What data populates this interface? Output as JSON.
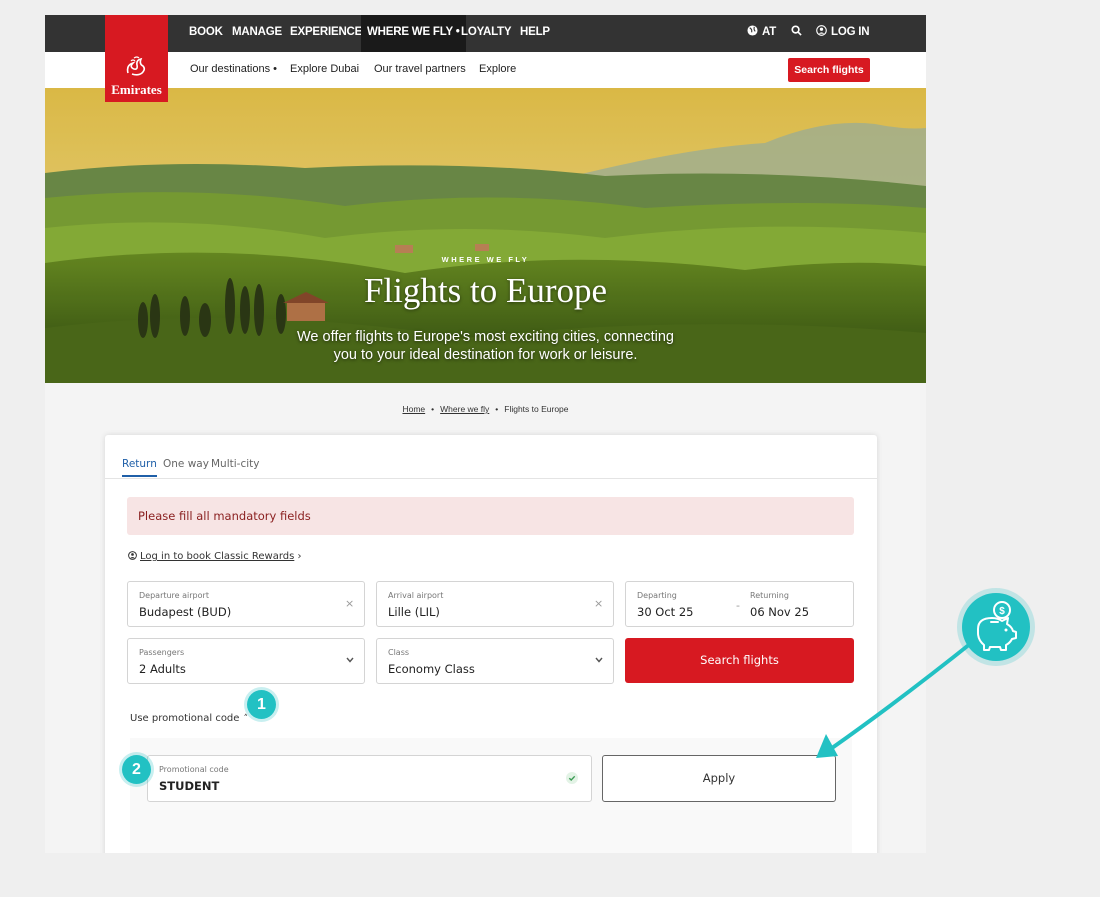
{
  "topnav": {
    "items": [
      "BOOK",
      "MANAGE",
      "EXPERIENCE",
      "WHERE WE FLY",
      "LOYALTY",
      "HELP"
    ],
    "region": "AT",
    "login": "LOG IN"
  },
  "logo": {
    "text": "Emirates"
  },
  "subnav": {
    "items": [
      "Our destinations",
      "Explore Dubai",
      "Our travel partners",
      "Explore"
    ],
    "search_button": "Search flights"
  },
  "hero": {
    "eyebrow": "WHERE WE FLY",
    "title": "Flights to Europe",
    "subtitle_line1": "We offer flights to Europe's most exciting cities, connecting",
    "subtitle_line2": "you to your ideal destination for work or leisure."
  },
  "breadcrumb": [
    "Home",
    "Where we fly",
    "Flights to Europe"
  ],
  "booking": {
    "tabs": [
      "Return",
      "One way",
      "Multi-city"
    ],
    "alert": "Please fill all mandatory fields",
    "rewards_link": "Log in to book Classic Rewards",
    "departure": {
      "label": "Departure airport",
      "value": "Budapest (BUD)"
    },
    "arrival": {
      "label": "Arrival airport",
      "value": "Lille (LIL)"
    },
    "departing": {
      "label": "Departing",
      "value": "30 Oct 25"
    },
    "returning": {
      "label": "Returning",
      "value": "06 Nov 25"
    },
    "passengers": {
      "label": "Passengers",
      "value": "2 Adults"
    },
    "class": {
      "label": "Class",
      "value": "Economy Class"
    },
    "search_button": "Search flights",
    "promo_toggle": "Use promotional code",
    "promo": {
      "label": "Promotional code",
      "value": "STUDENT"
    },
    "apply_button": "Apply"
  },
  "annotations": {
    "step1": "1",
    "step2": "2"
  },
  "colors": {
    "brand_red": "#d71921",
    "accent_teal": "#22c1c3",
    "link_blue": "#1f5fa8"
  }
}
